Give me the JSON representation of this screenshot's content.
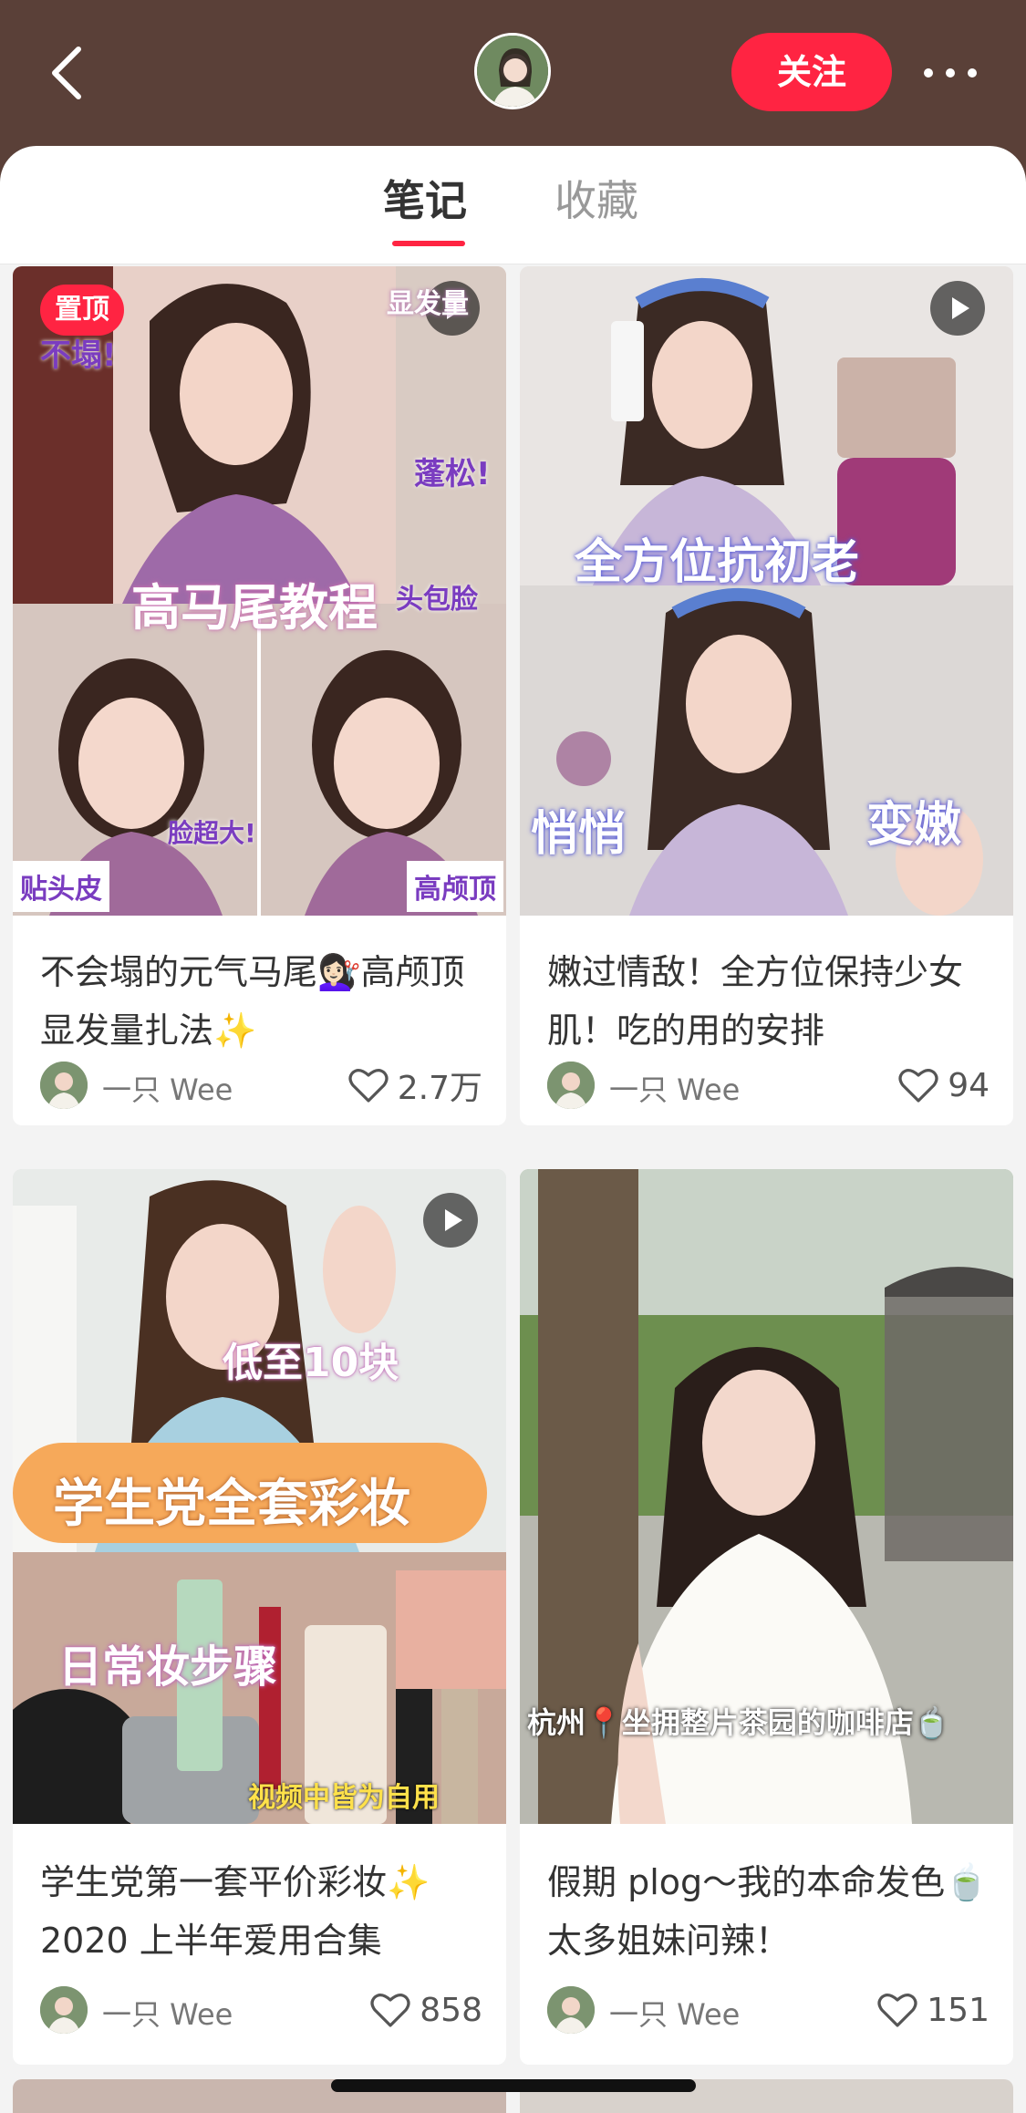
{
  "header": {
    "follow_label": "关注",
    "accent_color": "#ff2442",
    "background_color": "#5a4038"
  },
  "tabs": [
    {
      "label": "笔记",
      "active": true
    },
    {
      "label": "收藏",
      "active": false
    }
  ],
  "notes": [
    {
      "pinned_label": "置顶",
      "has_video": true,
      "overlay_texts": [
        "显发量",
        "不塌!",
        "蓬松!",
        "高马尾教程",
        "头包脸",
        "脸超大!",
        "贴头皮",
        "高颅顶"
      ],
      "title": "不会塌的元气马尾💇🏻‍♀️高颅顶显发量扎法✨",
      "author": "一只 Wee",
      "likes": "2.7万"
    },
    {
      "has_video": true,
      "overlay_texts": [
        "全方位抗初老",
        "悄悄",
        "变嫩"
      ],
      "title": "嫩过情敌！全方位保持少女肌！吃的用的安排",
      "author": "一只 Wee",
      "likes": "94"
    },
    {
      "has_video": true,
      "overlay_texts": [
        "低至10块",
        "学生党全套彩妆",
        "日常妆步骤",
        "视频中皆为自用"
      ],
      "title": "学生党第一套平价彩妆✨ 2020 上半年爱用合集",
      "author": "一只 Wee",
      "likes": "858"
    },
    {
      "has_video": false,
      "overlay_texts": [
        "杭州📍坐拥整片茶园的咖啡店🍵"
      ],
      "title": "假期 plog～我的本命发色🍵 太多姐妹问辣！",
      "author": "一只 Wee",
      "likes": "151"
    }
  ]
}
